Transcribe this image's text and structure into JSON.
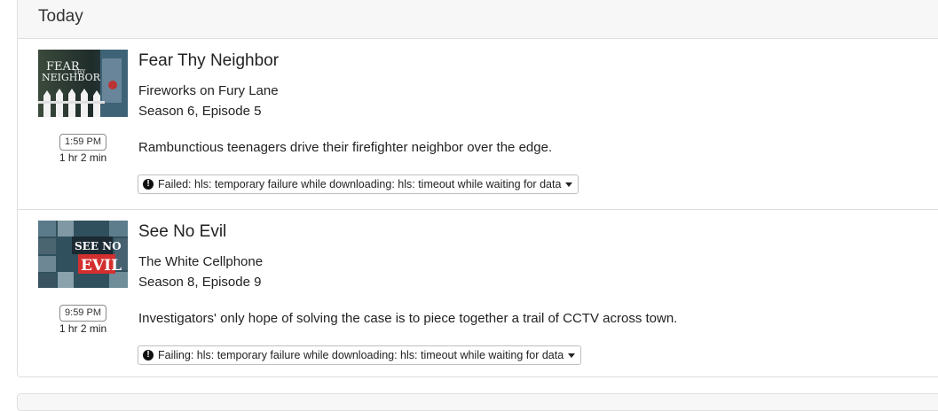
{
  "section": {
    "header": "Today"
  },
  "entries": [
    {
      "show_title": "Fear Thy Neighbor",
      "episode_title": "Fireworks on Fury Lane",
      "season_episode": "Season 6, Episode 5",
      "time": "1:59 PM",
      "duration": "1 hr 2 min",
      "description": "Rambunctious teenagers drive their firefighter neighbor over the edge.",
      "status": "Failed: hls: temporary failure while downloading: hls: timeout while waiting for data",
      "thumb_text": [
        "FEAR",
        "THY",
        "NEIGHBOR"
      ]
    },
    {
      "show_title": "See No Evil",
      "episode_title": "The White Cellphone",
      "season_episode": "Season 8, Episode 9",
      "time": "9:59 PM",
      "duration": "1 hr 2 min",
      "description": "Investigators' only hope of solving the case is to piece together a trail of CCTV across town.",
      "status": "Failing: hls: temporary failure while downloading: hls: timeout while waiting for data",
      "thumb_text": [
        "SEE NO",
        "EVIL"
      ]
    }
  ],
  "icons": {
    "status": "exclamation-circle-icon",
    "dropdown": "caret-down-icon"
  },
  "colors": {
    "header_bg": "#f7f7f7",
    "border": "#dfdfdf",
    "evil_red": "#d32f2f"
  }
}
